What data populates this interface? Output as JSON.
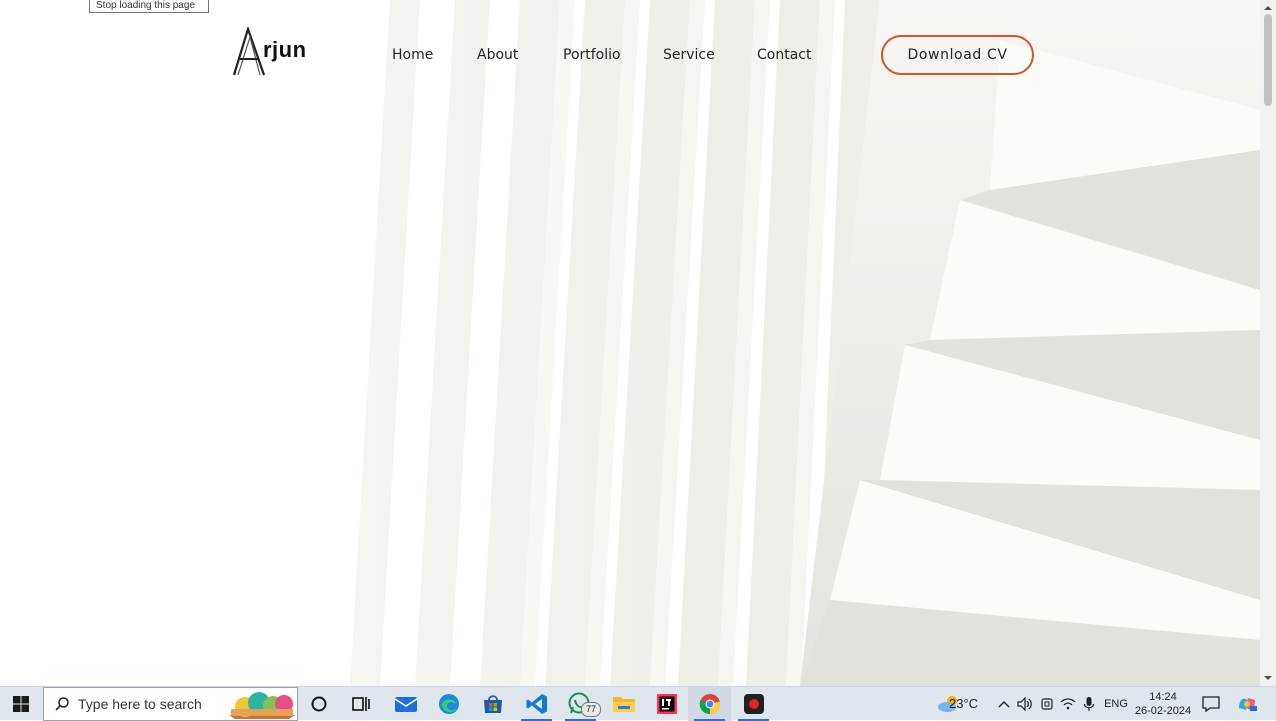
{
  "browser": {
    "tooltip": "Stop loading this page"
  },
  "site": {
    "logo_text": "rjun",
    "nav": [
      "Home",
      "About",
      "Portfolio",
      "Service",
      "Contact"
    ],
    "cta_label": "Download CV",
    "accent_color": "#d3532a"
  },
  "taskbar": {
    "search_placeholder": "Type here to search",
    "whatsapp_badge": "77",
    "weather": "23°C",
    "language": "ENG",
    "time": "14:24",
    "date": "26-02-2024",
    "apps": [
      "start-icon",
      "search-icon",
      "holi-highlight-icon",
      "cortana-icon",
      "task-view-icon",
      "mail-icon",
      "edge-icon",
      "store-icon",
      "vscode-icon",
      "whatsapp-icon",
      "file-explorer-icon",
      "intellij-icon",
      "chrome-icon",
      "recorder-icon"
    ]
  }
}
